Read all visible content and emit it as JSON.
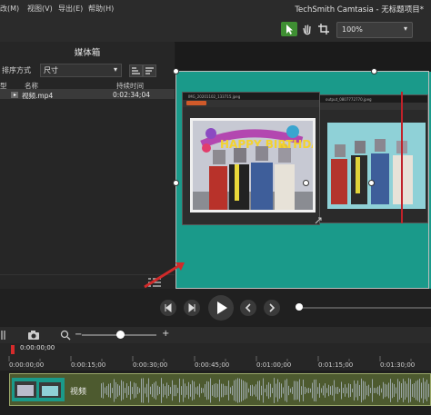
{
  "menu": {
    "items": [
      "改(M)",
      "视图(V)",
      "导出(E)",
      "帮助(H)"
    ],
    "app_title": "TechSmith Camtasia - 无标题项目*"
  },
  "toolbar": {
    "zoom_value": "100%",
    "tools": [
      "pointer-tool",
      "pan-tool",
      "crop-tool"
    ],
    "active_color": "#3f8f33"
  },
  "media_bin": {
    "title": "媒体箱",
    "sort_label": "排序方式",
    "sort_value": "尺寸",
    "columns": [
      "型",
      "名称",
      "持续时间"
    ],
    "rows": [
      {
        "name": "视频.mp4",
        "duration": "0:02:34;04"
      }
    ]
  },
  "canvas": {
    "frame_color": "#1a9a8a",
    "window1_title": "IMG_20201102_133715.jpeg",
    "window2_title": "output_0807772770.jpeg"
  },
  "timeline": {
    "playhead_time": "0:00:00;00",
    "ruler_labels": [
      "0:00:00;00",
      "0:00:15;00",
      "0:00:30;00",
      "0:00:45;00",
      "0:01:00;00",
      "0:01:15;00",
      "0:01:30;00"
    ],
    "clip_label": "视频",
    "clip_color": "#4d5a2f"
  }
}
